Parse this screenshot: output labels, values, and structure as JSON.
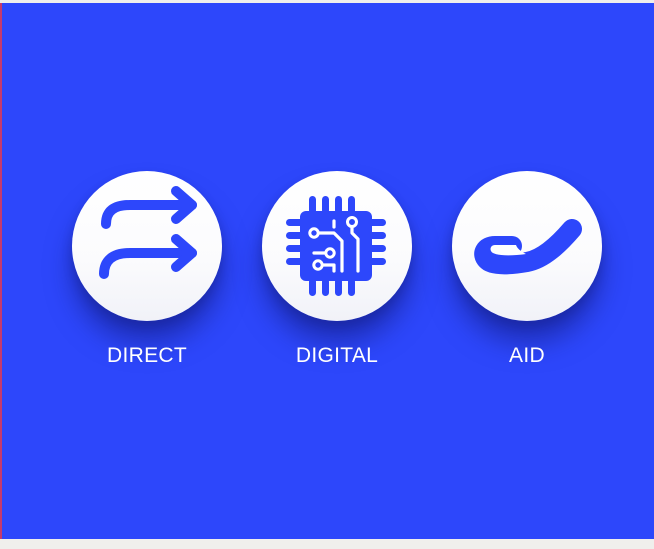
{
  "colors": {
    "background": "#2d47fb",
    "icon": "#2d47fb",
    "circle": "#ffffff",
    "label": "#ffffff"
  },
  "items": [
    {
      "label": "DIRECT",
      "icon": "double-arrow-icon"
    },
    {
      "label": "DIGITAL",
      "icon": "circuit-chip-icon"
    },
    {
      "label": "AID",
      "icon": "helping-hand-icon"
    }
  ]
}
